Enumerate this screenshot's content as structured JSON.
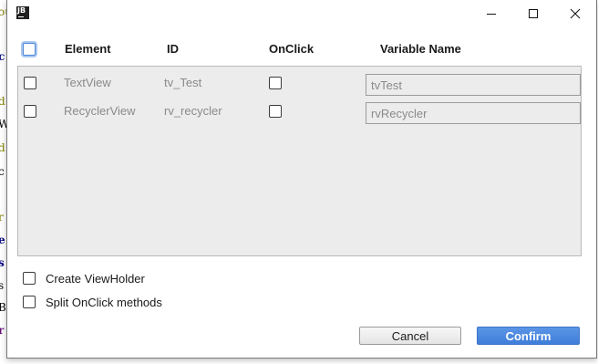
{
  "background_editor": {
    "fragments": [
      "ou",
      "c",
      "d",
      "W",
      "d",
      "c",
      "r",
      "e",
      "s",
      "s",
      "B",
      "r"
    ]
  },
  "titlebar": {
    "app_icon_label": "JB",
    "minimize_icon": "minimize-icon",
    "maximize_icon": "maximize-icon",
    "close_icon": "close-icon"
  },
  "table": {
    "headers": {
      "element": "Element",
      "id": "ID",
      "onclick": "OnClick",
      "variable_name": "Variable Name"
    },
    "select_all_checked": false,
    "rows": [
      {
        "selected": false,
        "element": "TextView",
        "id": "tv_Test",
        "onclick": false,
        "variable_name": "tvTest"
      },
      {
        "selected": false,
        "element": "RecyclerView",
        "id": "rv_recycler",
        "onclick": false,
        "variable_name": "rvRecycler"
      }
    ]
  },
  "options": {
    "create_viewholder": {
      "label": "Create ViewHolder",
      "checked": false
    },
    "split_onclick": {
      "label": "Split OnClick methods",
      "checked": false
    }
  },
  "buttons": {
    "cancel": "Cancel",
    "confirm": "Confirm"
  },
  "colors": {
    "accent": "#4a88dc",
    "panel_bg": "#ececec",
    "disabled_text": "#8a8a8a"
  }
}
